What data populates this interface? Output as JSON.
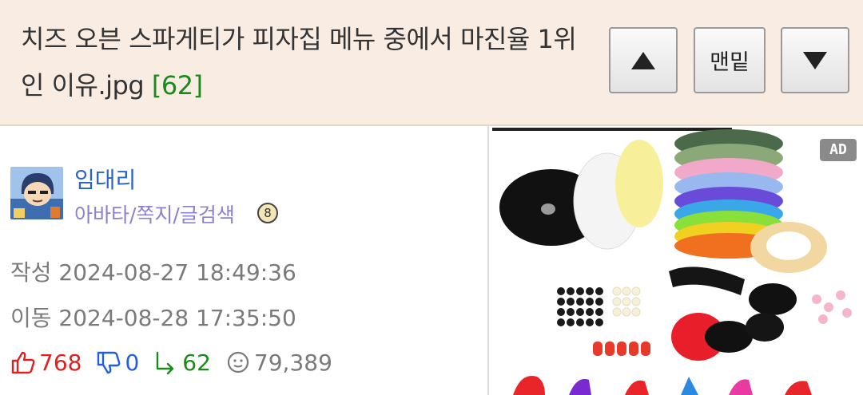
{
  "header": {
    "title": "치즈 오븐 스파게티가 피자집 메뉴 중에서 마진율 1위인 이유.jpg",
    "comment_count": "[62]",
    "bottom_label": "맨밑"
  },
  "author": {
    "name": "임대리",
    "links": "아바타/쪽지/글검색",
    "badge": "8"
  },
  "meta": {
    "written": "작성 2024-08-27 18:49:36",
    "moved": "이동 2024-08-28 17:35:50"
  },
  "stats": {
    "upvotes": "768",
    "downvotes": "0",
    "replies": "62",
    "views": "79,389"
  },
  "ad": {
    "label": "AD"
  },
  "colors": {
    "header_bg": "#f8ece3",
    "upvote": "#e02020",
    "downvote": "#2060e0",
    "reply": "#1b8a1b",
    "username": "#2a63c9",
    "links": "#8e7fcf"
  }
}
